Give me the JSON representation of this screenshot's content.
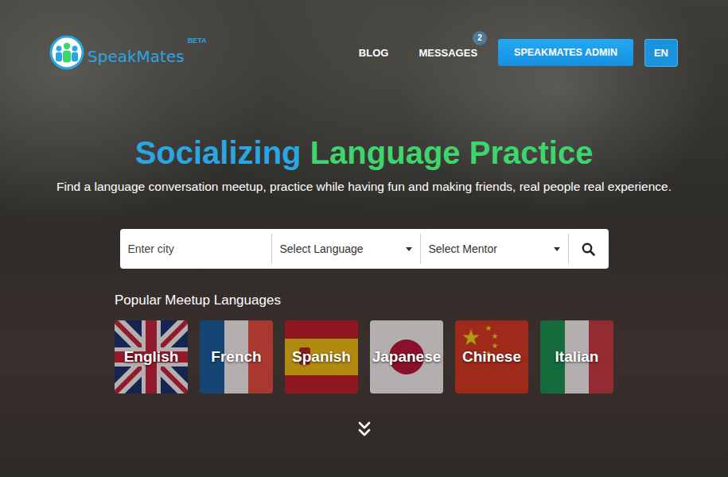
{
  "logo": {
    "name": "SpeakMates",
    "badge": "BETA"
  },
  "nav": [
    {
      "label": "BLOG",
      "kind": "link"
    },
    {
      "label": "MESSAGES",
      "kind": "link",
      "badge": "2"
    },
    {
      "label": "SPEAKMATES ADMIN",
      "kind": "button"
    },
    {
      "label": "EN",
      "kind": "lang"
    }
  ],
  "hero": {
    "title": [
      {
        "text": "Socializing",
        "color": "#2aa7e3"
      },
      {
        "text": "Language Practice",
        "color": "#3fd56d"
      }
    ],
    "subtitle": "Find a language conversation meetup, practice while having fun and making friends, real people real experience."
  },
  "search": {
    "city_placeholder": "Enter city",
    "language_placeholder": "Select Language",
    "mentor_placeholder": "Select Mentor"
  },
  "popular": {
    "title": "Popular Meetup Languages",
    "languages": [
      {
        "label": "English",
        "kind": "uk"
      },
      {
        "label": "French",
        "kind": "france"
      },
      {
        "label": "Spanish",
        "kind": "spain"
      },
      {
        "label": "Japanese",
        "kind": "japan"
      },
      {
        "label": "Chinese",
        "kind": "china"
      },
      {
        "label": "Italian",
        "kind": "italy"
      }
    ]
  }
}
